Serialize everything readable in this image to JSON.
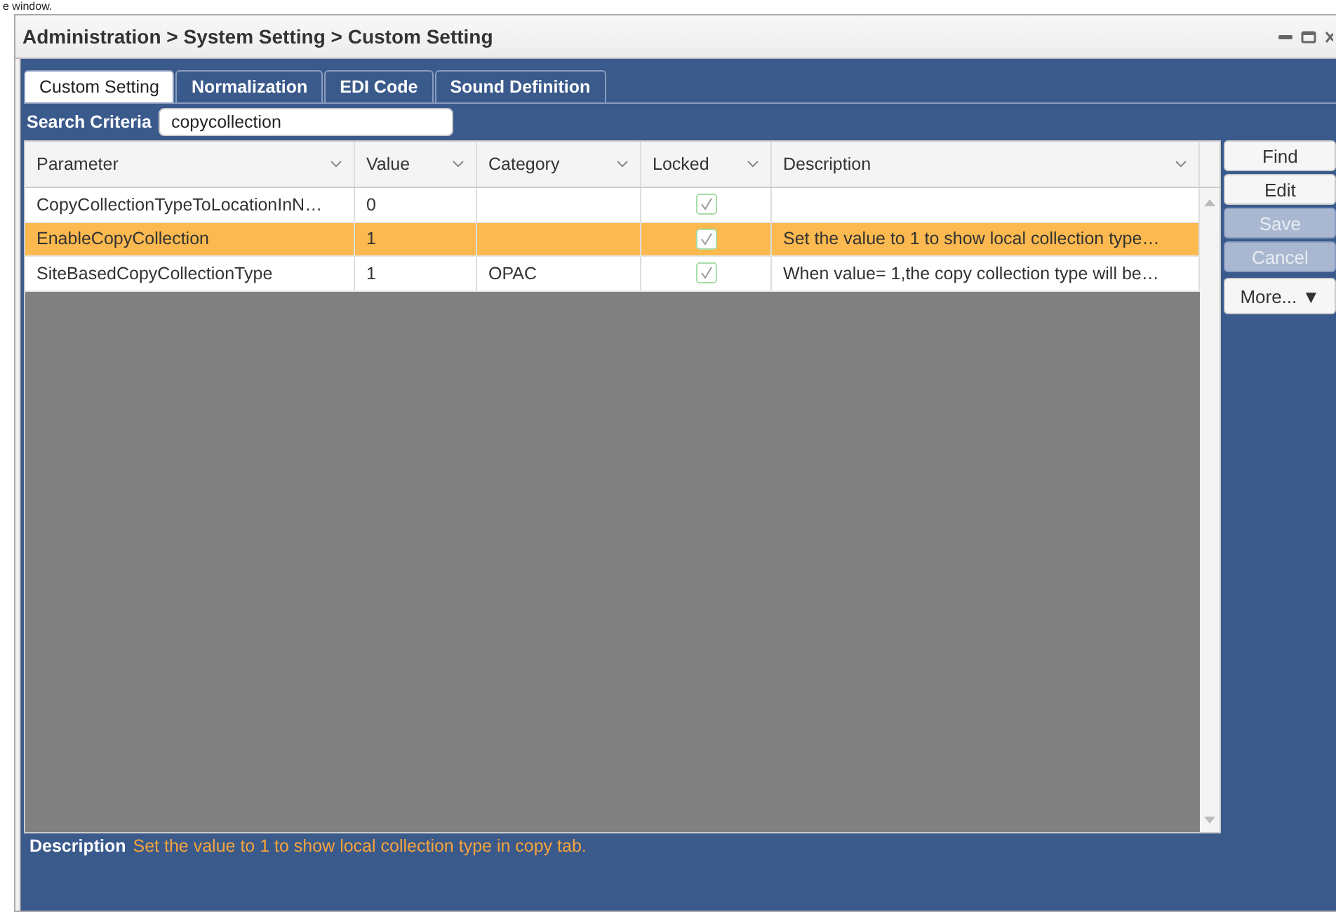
{
  "caption_fragment": "e window.",
  "window": {
    "title": "Administration > System Setting > Custom Setting"
  },
  "tabs": [
    {
      "label": "Custom Setting",
      "selected": true
    },
    {
      "label": "Normalization",
      "selected": false
    },
    {
      "label": "EDI Code",
      "selected": false
    },
    {
      "label": "Sound Definition",
      "selected": false
    }
  ],
  "search": {
    "label": "Search Criteria",
    "value": "copycollection"
  },
  "table": {
    "columns": [
      "Parameter",
      "Value",
      "Category",
      "Locked",
      "Description"
    ],
    "rows": [
      {
        "parameter": "CopyCollectionTypeToLocationInN…",
        "value": "0",
        "category": "",
        "locked": true,
        "description": "",
        "selected": false
      },
      {
        "parameter": "EnableCopyCollection",
        "value": "1",
        "category": "",
        "locked": true,
        "description": "Set the value to 1 to show local collection type…",
        "selected": true
      },
      {
        "parameter": "SiteBasedCopyCollectionType",
        "value": "1",
        "category": "OPAC",
        "locked": true,
        "description": "When value= 1,the copy collection type will be…",
        "selected": false
      }
    ]
  },
  "buttons": [
    {
      "label": "Find",
      "disabled": false
    },
    {
      "label": "Edit",
      "disabled": false
    },
    {
      "label": "Save",
      "disabled": true
    },
    {
      "label": "Cancel",
      "disabled": true
    },
    {
      "label": "More...",
      "disabled": false,
      "caret": "▼"
    }
  ],
  "description": {
    "label": "Description",
    "text": "Set the value to 1 to show local collection type in copy tab."
  }
}
